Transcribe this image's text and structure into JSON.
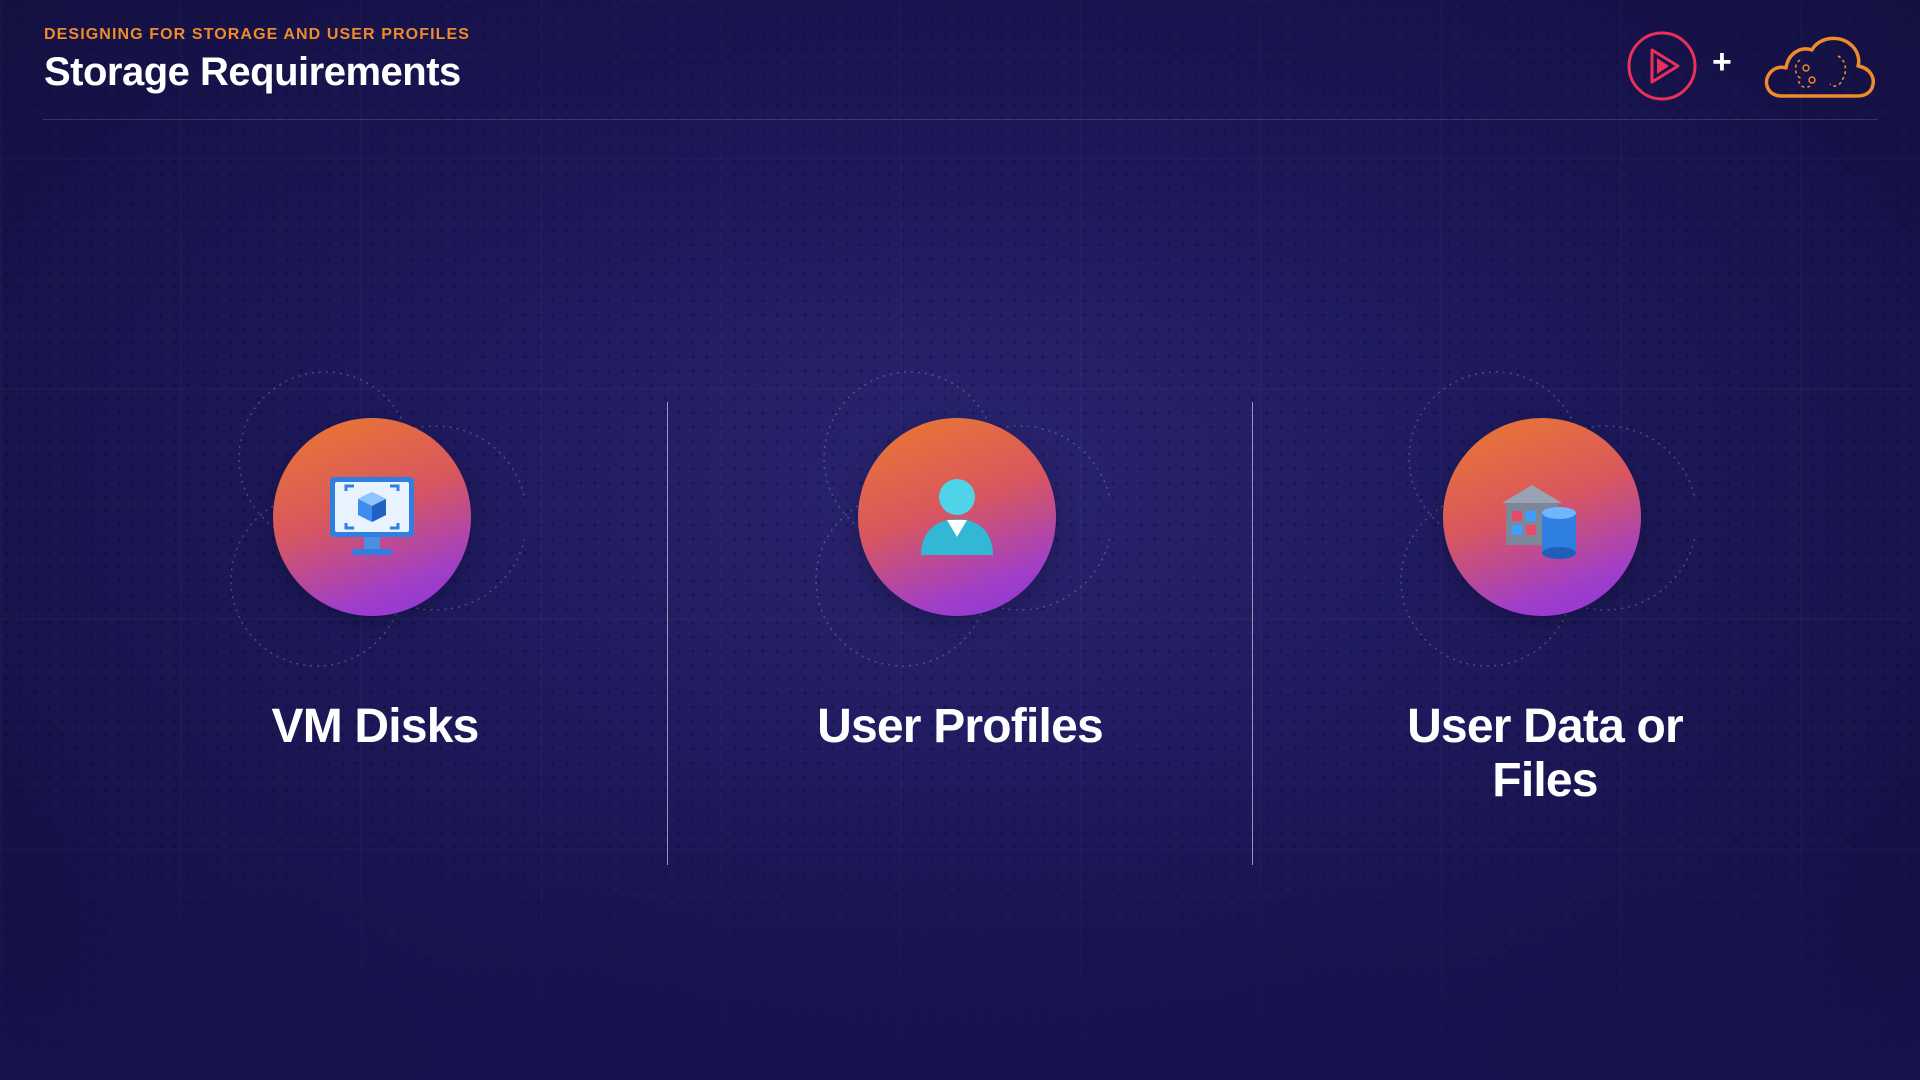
{
  "header": {
    "eyebrow": "DESIGNING FOR STORAGE AND USER PROFILES",
    "title": "Storage Requirements"
  },
  "logos": {
    "play": "play-logo-icon",
    "plus": "+",
    "cloud": "cloud-brain-logo-icon"
  },
  "items": [
    {
      "label": "VM Disks",
      "icon": "monitor-vm-icon"
    },
    {
      "label": "User Profiles",
      "icon": "user-icon"
    },
    {
      "label": "User Data or Files",
      "icon": "building-database-icon"
    }
  ],
  "colors": {
    "accent": "#f08a2a",
    "circle_start": "#ec7a2f",
    "circle_end": "#8b35d8",
    "background": "#1f1a5e"
  }
}
